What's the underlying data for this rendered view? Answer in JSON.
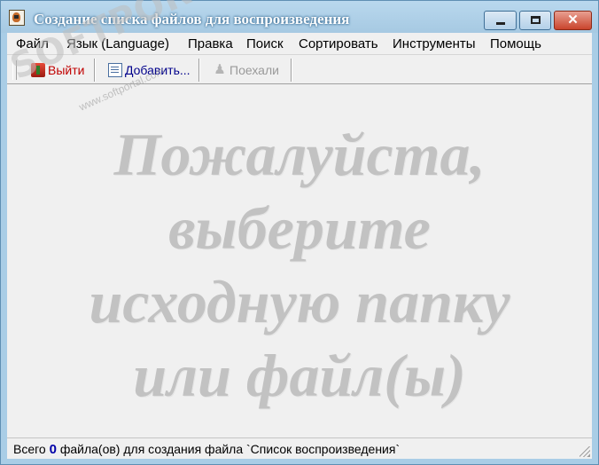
{
  "window": {
    "title": "Создание списка файлов для воспроизведения",
    "minimize_label": "",
    "maximize_label": "",
    "close_label": "✕"
  },
  "menu": {
    "items": [
      "Файл",
      "Язык (Language)",
      "Правка",
      "Поиск",
      "Сортировать",
      "Инструменты",
      "Помощь"
    ]
  },
  "toolbar": {
    "exit_label": "Выйти",
    "add_label": "Добавить...",
    "go_label": "Поехали"
  },
  "content": {
    "hint_lines": [
      "Пожалуйста,",
      "выберите",
      "исходную папку",
      "или файл(ы)"
    ]
  },
  "status": {
    "prefix": "Всего ",
    "count": "0",
    "suffix": " файла(ов) для создания файла `Список воспроизведения`"
  },
  "watermark": {
    "brand": "SOFTPORTAL",
    "url": "www.softportal.com"
  },
  "colors": {
    "title_bar": "#a9cde6",
    "exit_text": "#c00000",
    "add_text": "#00008b",
    "disabled_text": "#9a9a9a",
    "hint_text": "#c2c2c2",
    "count_text": "#0000a8"
  },
  "icons": {
    "app": "app-icon",
    "exit": "exit-icon",
    "add": "add-document-icon",
    "go": "run-icon"
  }
}
